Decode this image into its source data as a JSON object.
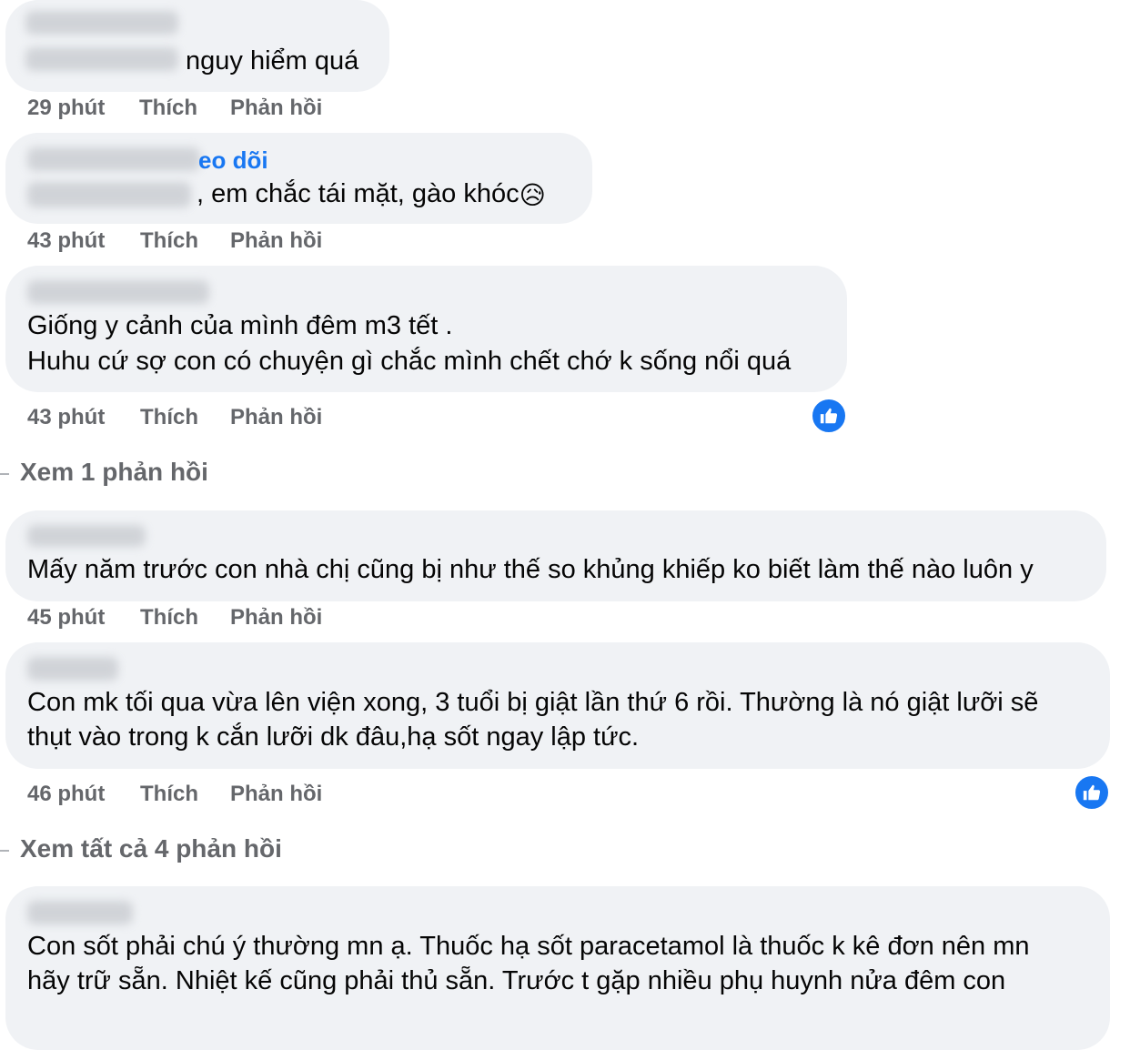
{
  "comments": [
    {
      "text_lines": [
        "nguy hiểm quá"
      ],
      "time": "29 phút",
      "like_label": "Thích",
      "reply_label": "Phản hồi"
    },
    {
      "follow_label": "eo dõi",
      "text_lines": [
        ", em chắc tái mặt, gào khóc"
      ],
      "emoji": "😥",
      "time": "43 phút",
      "like_label": "Thích",
      "reply_label": "Phản hồi"
    },
    {
      "text_lines": [
        "Giống y cảnh của mình đêm m3 tết .",
        "Huhu cứ sợ con có chuyện gì chắc mình chết chớ k sống nổi quá"
      ],
      "time": "43 phút",
      "like_label": "Thích",
      "reply_label": "Phản hồi",
      "reaction_icon": "like-icon"
    },
    {
      "text_lines": [
        "Mấy năm trước con nhà chị cũng bị như thế so khủng khiếp ko biết làm thế nào luôn y"
      ],
      "time": "45 phút",
      "like_label": "Thích",
      "reply_label": "Phản hồi"
    },
    {
      "text_lines": [
        "Con mk tối qua vừa lên viện xong, 3 tuổi bị giật lần thứ 6 rồi. Thường là nó giật lưỡi sẽ",
        "thụt vào trong k cắn lưỡi dk đâu,hạ sốt ngay lập tức."
      ],
      "time": "46 phút",
      "like_label": "Thích",
      "reply_label": "Phản hồi",
      "reaction_icon": "like-icon"
    },
    {
      "text_lines": [
        "Con sốt phải chú ý thường mn ạ. Thuốc hạ sốt paracetamol là thuốc k kê đơn nên mn",
        "hãy trữ sẵn. Nhiệt kế cũng phải thủ sẵn. Trước t gặp nhiều phụ huynh nửa đêm con"
      ]
    }
  ],
  "view_replies": [
    "Xem 1 phản hồi",
    "Xem tất cả 4 phản hồi"
  ],
  "colors": {
    "bubble": "#f0f2f5",
    "meta": "#65676b",
    "link": "#1877f2",
    "like_badge": "#1877f2"
  }
}
